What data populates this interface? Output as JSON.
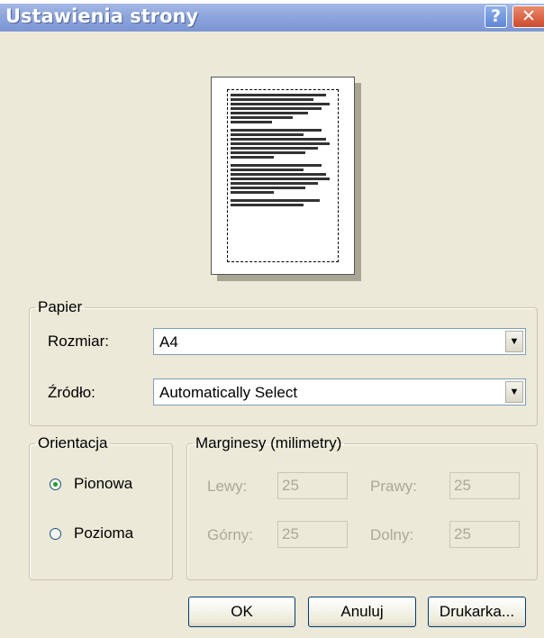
{
  "window": {
    "title": "Ustawienia strony",
    "help_glyph": "?",
    "close_glyph": "✕"
  },
  "paper": {
    "legend": "Papier",
    "size_label": "Rozmiar:",
    "size_value": "A4",
    "source_label": "Źródło:",
    "source_value": "Automatically Select"
  },
  "orientation": {
    "legend": "Orientacja",
    "options": [
      {
        "label": "Pionowa",
        "checked": true
      },
      {
        "label": "Pozioma",
        "checked": false
      }
    ]
  },
  "margins": {
    "legend": "Marginesy (milimetry)",
    "left_label": "Lewy:",
    "left_value": "25",
    "right_label": "Prawy:",
    "right_value": "25",
    "top_label": "Górny:",
    "top_value": "25",
    "bottom_label": "Dolny:",
    "bottom_value": "25"
  },
  "buttons": {
    "ok": "OK",
    "cancel": "Anuluj",
    "printer": "Drukarka..."
  }
}
